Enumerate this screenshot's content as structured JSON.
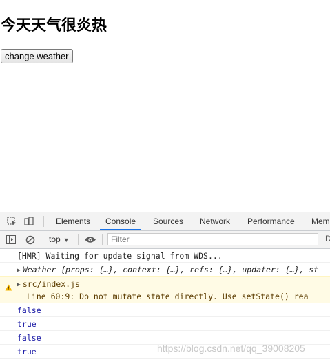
{
  "page": {
    "heading": "今天天气很炎热",
    "button_label": "change weather"
  },
  "devtools": {
    "tabs": [
      "Elements",
      "Console",
      "Sources",
      "Network",
      "Performance",
      "Mem"
    ],
    "active_tab": "Console",
    "context": "top",
    "filter_placeholder": "Filter",
    "toolbar_right": "D",
    "messages": [
      {
        "type": "log",
        "text": "[HMR] Waiting for update signal from WDS..."
      },
      {
        "type": "object",
        "name": "Weather",
        "preview": "{props: {…}, context: {…}, refs: {…}, updater: {…}, st"
      },
      {
        "type": "warning",
        "source": "src/index.js",
        "detail": "Line 60:9:  Do not mutate state directly. Use setState()  rea"
      },
      {
        "type": "value",
        "text": "false"
      },
      {
        "type": "value",
        "text": "true"
      },
      {
        "type": "value",
        "text": "false"
      },
      {
        "type": "value",
        "text": "true"
      }
    ]
  },
  "watermark": "https://blog.csdn.net/qq_39008205",
  "colors": {
    "active_tab_underline": "#1a73e8",
    "boolean_value": "#1a1aa6",
    "warning_bg": "#fffbe5"
  }
}
